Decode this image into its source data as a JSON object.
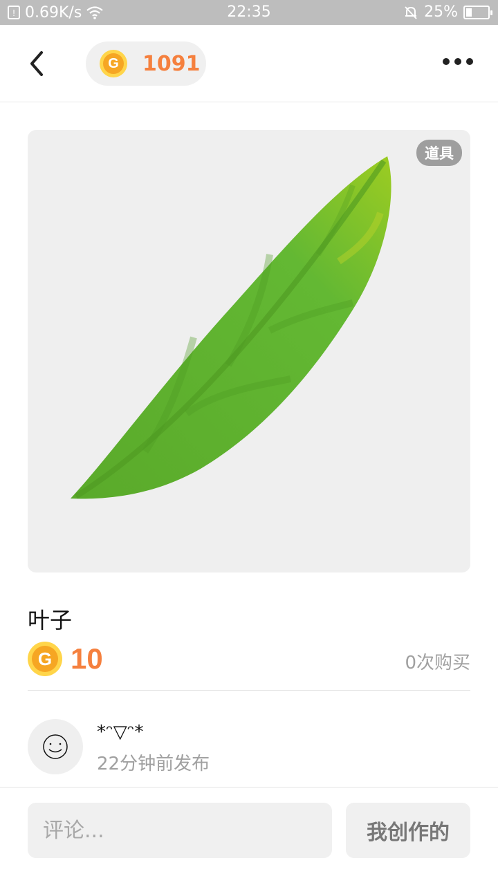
{
  "status_bar": {
    "net_speed": "0.69K/s",
    "time": "22:35",
    "battery": "25%",
    "battery_level": 0.25
  },
  "header": {
    "coin_balance": "1091",
    "coin_letter": "G"
  },
  "item": {
    "tag": "道具",
    "title": "叶子",
    "price": "10",
    "purchases": "0次购买"
  },
  "author": {
    "name": "*ᵔ▽ᵔ*",
    "posted": "22分钟前发布"
  },
  "bottom": {
    "comment_placeholder": "评论...",
    "my_creations": "我创作的"
  },
  "colors": {
    "accent": "#f5803e",
    "coin_outer": "#ffd54a",
    "coin_inner": "#f6a623",
    "leaf": "#5db52f"
  }
}
